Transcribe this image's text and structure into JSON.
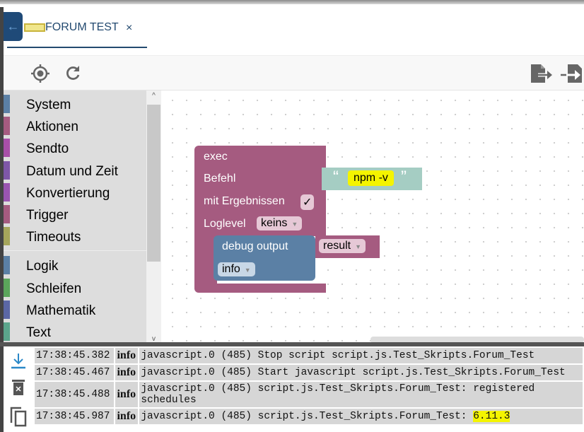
{
  "tab": {
    "title": "FORUM TEST",
    "close": "×",
    "logo_text": "blockly"
  },
  "icons": {
    "back": "arrow-left-icon",
    "target": "crosshair-icon",
    "reload": "refresh-icon",
    "export": "export-icon",
    "import": "import-icon"
  },
  "sidebar": {
    "items": [
      {
        "label": "System",
        "color": "#5b80a5"
      },
      {
        "label": "Aktionen",
        "color": "#a55b80"
      },
      {
        "label": "Sendto",
        "color": "#a84fa8"
      },
      {
        "label": "Datum und Zeit",
        "color": "#7e57a8"
      },
      {
        "label": "Konvertierung",
        "color": "#9a55b0"
      },
      {
        "label": "Trigger",
        "color": "#a55b80"
      },
      {
        "label": "Timeouts",
        "color": "#a5a55b"
      },
      {
        "label": "Logik",
        "color": "#5b80a5"
      },
      {
        "label": "Schleifen",
        "color": "#5ba55b"
      },
      {
        "label": "Mathematik",
        "color": "#5b67a5"
      },
      {
        "label": "Text",
        "color": "#5ba58c"
      }
    ]
  },
  "blocks": {
    "exec": {
      "title": "exec",
      "befehl": "Befehl",
      "mit": "mit Ergebnissen",
      "check": "✓",
      "loglevel": "Loglevel",
      "loglevel_value": "keins",
      "color": "#a55b80"
    },
    "string": {
      "open": "“",
      "value": "npm -v",
      "close": "”",
      "color": "#a5cdc3"
    },
    "debug": {
      "title": "debug output",
      "level": "info",
      "var": "result",
      "color": "#5b80a5"
    }
  },
  "log": {
    "rows": [
      {
        "time": "17:38:45.382",
        "level": "info",
        "message": "javascript.0 (485) Stop script script.js.Test_Skripts.Forum_Test"
      },
      {
        "time": "17:38:45.467",
        "level": "info",
        "message": "javascript.0 (485) Start javascript script.js.Test_Skripts.Forum_Test"
      },
      {
        "time": "17:38:45.488",
        "level": "info",
        "message": "javascript.0 (485) script.js.Test_Skripts.Forum_Test: registered",
        "message2": "schedules"
      },
      {
        "time": "17:38:45.987",
        "level": "info",
        "message": "javascript.0 (485) script.js.Test_Skripts.Forum_Test: ",
        "highlight": "6.11.3"
      }
    ]
  }
}
